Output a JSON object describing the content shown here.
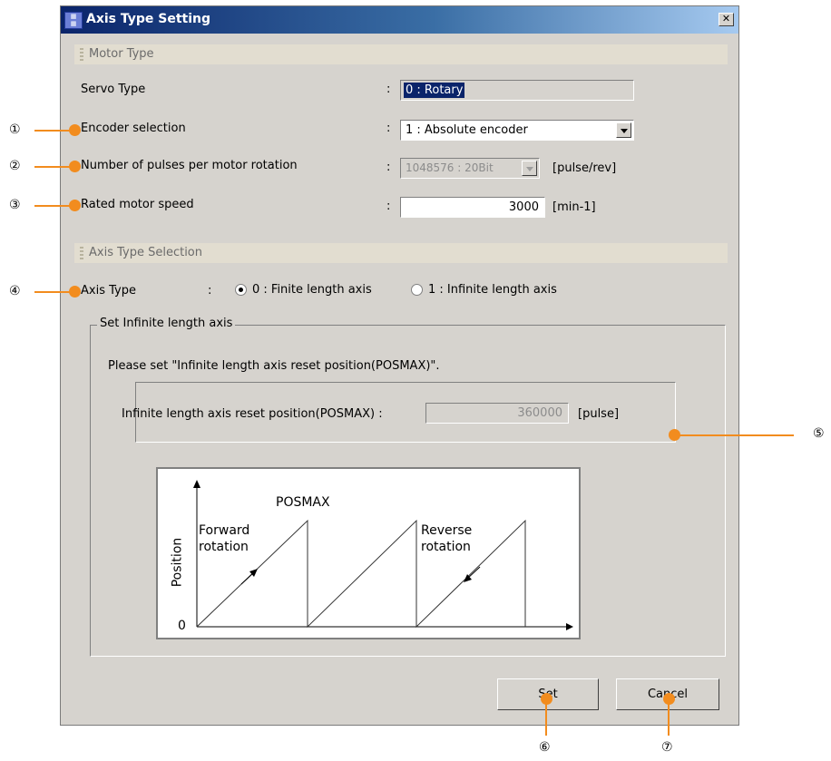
{
  "window": {
    "title": "Axis Type Setting",
    "close_glyph": "✕"
  },
  "motor_type": {
    "section_title": "Motor Type",
    "servo_type": {
      "label": "Servo Type",
      "colon": ":",
      "value": "0 : Rotary"
    },
    "encoder": {
      "label": "Encoder selection",
      "colon": ":",
      "value": "1 : Absolute encoder"
    },
    "pulses": {
      "label": "Number of pulses per motor rotation",
      "colon": ":",
      "value": "1048576 : 20Bit",
      "unit": "[pulse/rev]"
    },
    "speed": {
      "label": "Rated motor speed",
      "colon": ":",
      "value": "3000",
      "unit": "[min-1]"
    }
  },
  "axis_type_selection": {
    "section_title": "Axis Type Selection",
    "axis_type": {
      "label": "Axis Type",
      "colon": ":",
      "options": [
        "0 : Finite length axis",
        "1 : Infinite length axis"
      ],
      "selected": "0 : Finite length axis"
    }
  },
  "infinite_group": {
    "title": "Set Infinite length axis",
    "instruction": "Please set \"Infinite length axis reset position(POSMAX)\".",
    "posmax": {
      "label": "Infinite length axis reset position(POSMAX) :",
      "value": "360000",
      "unit": "[pulse]"
    },
    "diagram": {
      "posmax_label": "POSMAX",
      "forward_label_1": "Forward",
      "forward_label_2": "rotation",
      "reverse_label_1": "Reverse",
      "reverse_label_2": "rotation",
      "y_label": "Position",
      "origin": "0"
    }
  },
  "buttons": {
    "set": "Set",
    "cancel": "Cancel"
  },
  "callouts": [
    "①",
    "②",
    "③",
    "④",
    "⑤",
    "⑥",
    "⑦"
  ],
  "colors": {
    "callout": "#f28c1e",
    "dialog_bg": "#d6d3ce",
    "title_start": "#0a246a",
    "title_end": "#a6caf0"
  }
}
